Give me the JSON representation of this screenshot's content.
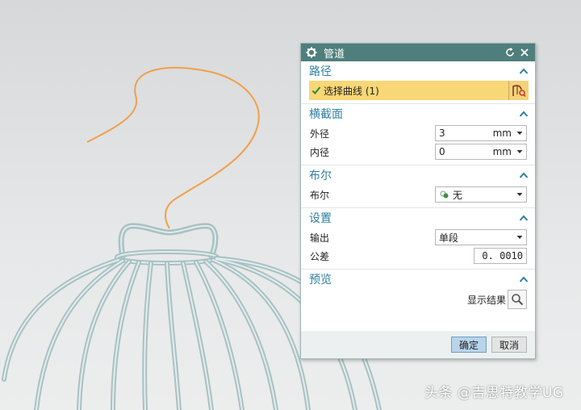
{
  "dialog": {
    "title": "管道",
    "sections": {
      "path": {
        "header": "路径",
        "select_curve": "选择曲线 (1)"
      },
      "cross_section": {
        "header": "横截面",
        "outer_label": "外径",
        "outer_value": "3",
        "outer_unit": "mm",
        "inner_label": "内径",
        "inner_value": "0",
        "inner_unit": "mm"
      },
      "boolean": {
        "header": "布尔",
        "label": "布尔",
        "value": "无"
      },
      "settings": {
        "header": "设置",
        "output_label": "输出",
        "output_value": "单段",
        "tolerance_label": "公差",
        "tolerance_value": "0. 0010"
      },
      "preview": {
        "header": "预览",
        "show_result": "显示结果"
      }
    },
    "ok_label": "确定",
    "cancel_label": "取消"
  },
  "watermark": "头条 @吉思特教学UG",
  "icons": {
    "title": "gear-icon",
    "reset": "reset-icon",
    "close": "close-icon",
    "collapse": "caret-up-icon",
    "check": "check-icon",
    "curve": "curve-select-icon",
    "dropdown": "dropdown-arrow-icon",
    "boolean": "boolean-none-icon",
    "search": "magnifier-icon"
  },
  "colors": {
    "titlebar": "#4e7f7c",
    "section_header": "#2f7fa0",
    "selection_highlight": "#f8d776",
    "ok_button": "#b7d4ea",
    "curve": "#f0a04b",
    "cage": "#bccfd0"
  }
}
